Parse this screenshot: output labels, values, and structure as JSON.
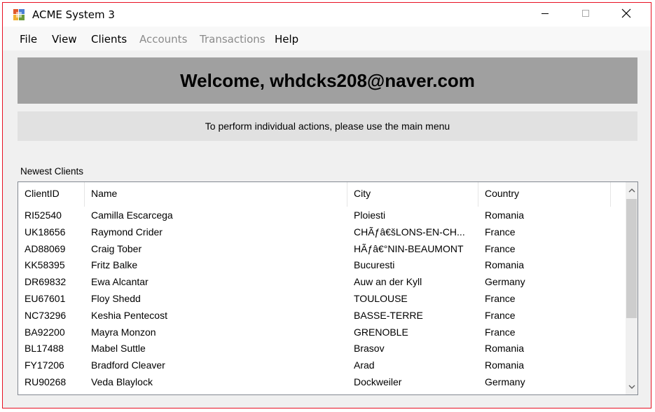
{
  "window": {
    "title": "ACME System 3"
  },
  "menu": {
    "file": "File",
    "view": "View",
    "clients": "Clients",
    "accounts": "Accounts",
    "transactions": "Transactions",
    "help": "Help"
  },
  "banner": {
    "welcome": "Welcome, whdcks208@naver.com"
  },
  "info": {
    "text": "To perform individual actions, please use the main menu"
  },
  "clients_section": {
    "label": "Newest Clients",
    "columns": [
      "ClientID",
      "Name",
      "City",
      "Country"
    ],
    "rows": [
      [
        "RI52540",
        "Camilla Escarcega",
        "Ploiesti",
        "Romania"
      ],
      [
        "UK18656",
        "Raymond Crider",
        "CHÃƒâ€šLONS-EN-CH...",
        "France"
      ],
      [
        "AD88069",
        "Craig Tober",
        "HÃƒâ€°NIN-BEAUMONT",
        "France"
      ],
      [
        "KK58395",
        "Fritz Balke",
        "Bucuresti",
        "Romania"
      ],
      [
        "DR69832",
        "Ewa Alcantar",
        "Auw an der Kyll",
        "Germany"
      ],
      [
        "EU67601",
        "Floy Shedd",
        "TOULOUSE",
        "France"
      ],
      [
        "NC73296",
        "Keshia Pentecost",
        "BASSE-TERRE",
        "France"
      ],
      [
        "BA92200",
        "Mayra Monzon",
        "GRENOBLE",
        "France"
      ],
      [
        "BL17488",
        "Mabel Suttle",
        "Brasov",
        "Romania"
      ],
      [
        "FY17206",
        "Bradford Cleaver",
        "Arad",
        "Romania"
      ],
      [
        "RU90268",
        "Veda Blaylock",
        "Dockweiler",
        "Germany"
      ]
    ]
  },
  "colors": {
    "banner_bg": "#a0a0a0",
    "info_bg": "#e1e1e1",
    "window_border": "#e81123",
    "disabled_menu": "#8b8b8b"
  },
  "icons": {
    "app": "app-window-icon",
    "minimize": "minimize-icon",
    "maximize": "maximize-icon",
    "close": "close-icon",
    "scroll_up": "chevron-up-icon",
    "scroll_down": "chevron-down-icon"
  }
}
